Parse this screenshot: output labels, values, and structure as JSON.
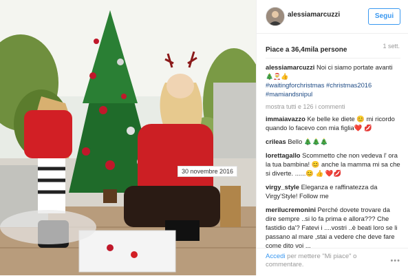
{
  "photo": {
    "date_label": "30 novembre 2016"
  },
  "header": {
    "username": "alessiamarcuzzi",
    "follow_label": "Segui"
  },
  "stats": {
    "likes": "Piace a 36,4mila persone",
    "age": "1 sett."
  },
  "caption": {
    "user": "alessiamarcuzzi",
    "text": "Noi ci siamo portate avanti",
    "emoji": "🎄🎅👍",
    "hashtags": "#waitingforchristmas #christmas2016 #mamiandsnipul"
  },
  "more_comments": "mostra tutti e 126 i commenti",
  "comments": [
    {
      "user": "immaiavazzo",
      "text": "Ke belle ke diete 😊 mi ricordo quando lo facevo con mia figlia❤️ 💋"
    },
    {
      "user": "crileas",
      "text": "Bello 🎄🎄🎄"
    },
    {
      "user": "lorettagallo",
      "text": "Scommetto che non vedeva l' ora la tua bambina! 😊 anche la mamma mi sa che si diverte. ......😊 👍 ❤️💋"
    },
    {
      "user": "virgy_style",
      "text": "Eleganza e raffinatezza da Virgy'Style! Follow me"
    },
    {
      "user": "merilucremonini",
      "text": "Perché dovete trovare da dire sempre ..si lo fa prima e allora??? Che fastidio da'? Fatevi i ....vostri ..è beati loro se li passano al mare ,stai a vedere che deve fare come dito voi ..."
    }
  ],
  "footer": {
    "login_link": "Accedi",
    "login_text": " per mettere \"Mi piace\" o commentare.",
    "options": "•••"
  }
}
